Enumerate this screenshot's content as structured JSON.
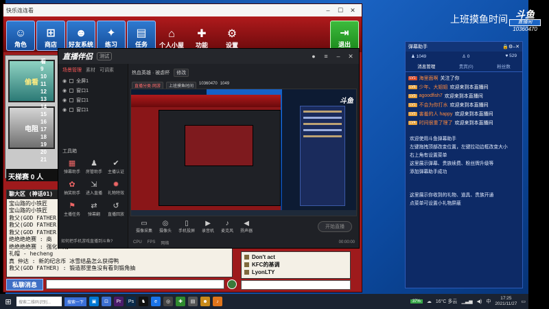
{
  "game": {
    "window_title": "快乐连连看",
    "toolbar": [
      {
        "label": "角色",
        "icon": "character-icon"
      },
      {
        "label": "商店",
        "icon": "cart-icon"
      },
      {
        "label": "好友系统",
        "icon": "friends-icon"
      },
      {
        "label": "练习",
        "icon": "practice-icon"
      },
      {
        "label": "任务",
        "icon": "task-icon"
      },
      {
        "label": "个人小屋",
        "icon": "house-icon"
      },
      {
        "label": "功能",
        "icon": "function-icon"
      },
      {
        "label": "设置",
        "icon": "gear-icon"
      }
    ],
    "exit_label": "退出",
    "cards": [
      "偷看",
      "电阻"
    ],
    "score_header": "看",
    "scores": [
      "9",
      "10",
      "11",
      "12",
      "13",
      "14",
      "15",
      "16",
      "17",
      "18",
      "19",
      "20",
      "21"
    ],
    "tianti": "天梯赛 0 人",
    "chat_header": "聊大区 (神话01)",
    "chat_lines": [
      "宝山路的小铁匠",
      "宝山路的小铁匠",
      "救父(GOD FATHER",
      "救父(GOD FATHER",
      "救父(GOD FATHER",
      "绝绝绝绝赛 : 商",
      "绝绝绝绝赛 : 强化和成",
      "礼帽 - hecheng",
      "真  仲达 : 新的纪念币 冰雪结晶怎么获得鸭",
      "救父(GOD FATHER) : 锻造那里鱼没有看到锻角抽"
    ],
    "private_btn": "私聊消息",
    "users": [
      "Don't act",
      "KFC的基调",
      "LyonLTY"
    ]
  },
  "obs": {
    "app_name": "直播伴侣",
    "badge": "测试",
    "side_tabs": [
      "场景管理",
      "素材",
      "可调素"
    ],
    "scenes": [
      "全屏1",
      "窗口1",
      "窗口1",
      "窗口1"
    ],
    "tools_label": "工具箱",
    "tools": [
      {
        "label": "弹幕助手",
        "icon": "danmaku-icon"
      },
      {
        "label": "房管助手",
        "icon": "admin-icon"
      },
      {
        "label": "主播认证",
        "icon": "verify-icon"
      },
      {
        "label": "抽奖助手",
        "icon": "lottery-icon"
      },
      {
        "label": "进入直播",
        "icon": "enter-icon"
      },
      {
        "label": "礼物特效",
        "icon": "gift-icon"
      },
      {
        "label": "主播任务",
        "icon": "mission-icon"
      },
      {
        "label": "弹幕翻",
        "icon": "flip-icon"
      },
      {
        "label": "直播回放",
        "icon": "replay-icon"
      }
    ],
    "notice": "如何把手机游戏直播到斗鱼?",
    "room_title": "热血英雄 · 被虐杯",
    "room_tag": "修改",
    "sub_tags": [
      "直播分类·网游",
      "上班摸鱼时间",
      "10360470",
      "1049"
    ],
    "controls": [
      "摄像采集",
      "摄像头",
      "手机投屏",
      "录音机",
      "麦克风",
      "扬声器"
    ],
    "start_label": "开始直播",
    "status": [
      "CPU",
      "FPS",
      "网络",
      "00:00:00"
    ]
  },
  "desktop": {
    "title": "上班摸鱼时间",
    "logo_big": "斗鱼",
    "logo_small": "直播间",
    "room_no": "10360470"
  },
  "danmaku": {
    "title": "弹幕助手",
    "stats": [
      "1049",
      "0",
      "529"
    ],
    "tabs": [
      "消息管理",
      "贵宾(0)",
      "粉丝数"
    ],
    "messages": [
      {
        "level": "LV1",
        "user": "海里面啊",
        "text": "关注了你"
      },
      {
        "level": "LV6",
        "user": "少年、大姐姐",
        "text": "欢迎来到本直播间"
      },
      {
        "level": "LV3",
        "user": "agoodfish7",
        "text": "欢迎来到本直播间"
      },
      {
        "level": "LV1",
        "user": "不会为你打水",
        "text": "欢迎来到本直播间"
      },
      {
        "level": "LV2",
        "user": "害羞的人 happy",
        "text": "欢迎来到本直播间"
      },
      {
        "level": "LV4",
        "user": "时间很重了理了",
        "text": "欢迎来到本直播间"
      }
    ],
    "help1": [
      "欢迎使用斗鱼弹幕助手",
      "左键拖拽顶部改变位置，左键拉动边框改变大小",
      "右上角有设置菜单",
      "这里展示弹幕、贵族续费、粉丝牌升级等",
      "添加弹幕助手成功"
    ],
    "help2": [
      "这里展示你收到的礼物、道具、贵族开通",
      "点菜单可设置小礼物屏蔽"
    ]
  },
  "taskbar": {
    "search_placeholder": "搜索二维码识别...",
    "search_btn": "搜索一下",
    "battery": "37%",
    "weather": "16°C 多云",
    "input_lang": "中",
    "time": "17:25",
    "date": "2021/11/27"
  }
}
